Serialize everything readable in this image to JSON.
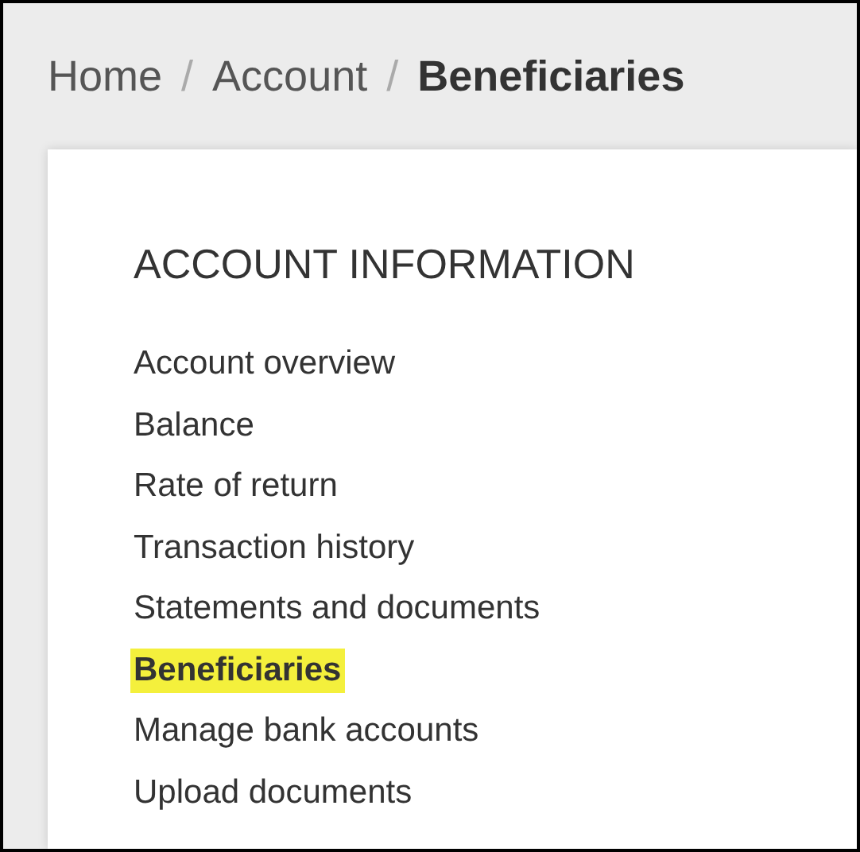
{
  "breadcrumb": [
    {
      "label": "Home",
      "selected": false
    },
    {
      "label": "Account",
      "selected": false
    },
    {
      "label": "Beneficiaries",
      "selected": true
    }
  ],
  "breadcrumb_separator": "/",
  "sidebar": {
    "heading": "ACCOUNT INFORMATION",
    "items": [
      {
        "label": "Account overview",
        "selected": false
      },
      {
        "label": "Balance",
        "selected": false
      },
      {
        "label": "Rate of return",
        "selected": false
      },
      {
        "label": "Transaction history",
        "selected": false
      },
      {
        "label": "Statements and documents",
        "selected": false
      },
      {
        "label": "Beneficiaries",
        "selected": true
      },
      {
        "label": "Manage bank accounts",
        "selected": false
      },
      {
        "label": "Upload documents",
        "selected": false
      }
    ]
  }
}
